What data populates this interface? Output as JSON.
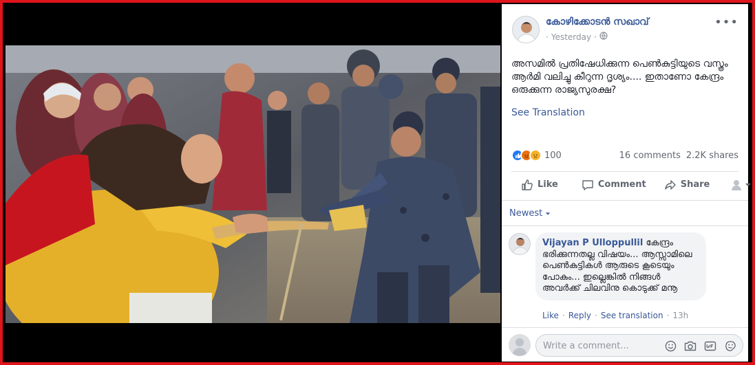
{
  "post": {
    "author": "കോഴിക്കോടൻ സഖാവ്",
    "timestamp": "Yesterday",
    "privacy_icon": "globe-icon",
    "text": "അസമിൽ പ്രതിഷേധിക്കുന്ന പെൺകുട്ടിയുടെ വസ്ത്രം ആർമി വലിച്ചു കീറുന്ന ദൃശ്യം.... ഇതാണോ കേന്ദ്രം ഒരുക്കുന്ന രാജ്യസുരക്ഷ?",
    "see_translation": "See Translation"
  },
  "stats": {
    "reactions": [
      "like-icon",
      "angry-icon",
      "sad-icon"
    ],
    "reaction_count": "100",
    "comments": "16 comments",
    "shares": "2.2K shares"
  },
  "actions": {
    "like": "Like",
    "comment": "Comment",
    "share": "Share"
  },
  "comments_sort": {
    "label": "Newest"
  },
  "comments": [
    {
      "author": "Vijayan P Ulloppullil",
      "text": "കേന്ദ്രം ഭരിക്കുന്നതല്ല വിഷയം... ആസ്സാമിലെ പെൺകുട്ടികൾ ആരുടെ കൂടെയും പോകും... ഇല്ലെങ്കിൽ നിങ്ങൾ അവർക്ക് ചിലവിനു കൊടുക്ക് മനൂ",
      "like": "Like",
      "reply": "Reply",
      "see_translation": "See translation",
      "time": "13h"
    }
  ],
  "write_comment": {
    "placeholder": "Write a comment...",
    "icons": [
      "emoji-icon",
      "camera-icon",
      "gif-icon",
      "sticker-icon"
    ]
  },
  "colors": {
    "frame": "#e0141b",
    "link": "#385898",
    "text": "#1d2129",
    "muted": "#90949c"
  }
}
